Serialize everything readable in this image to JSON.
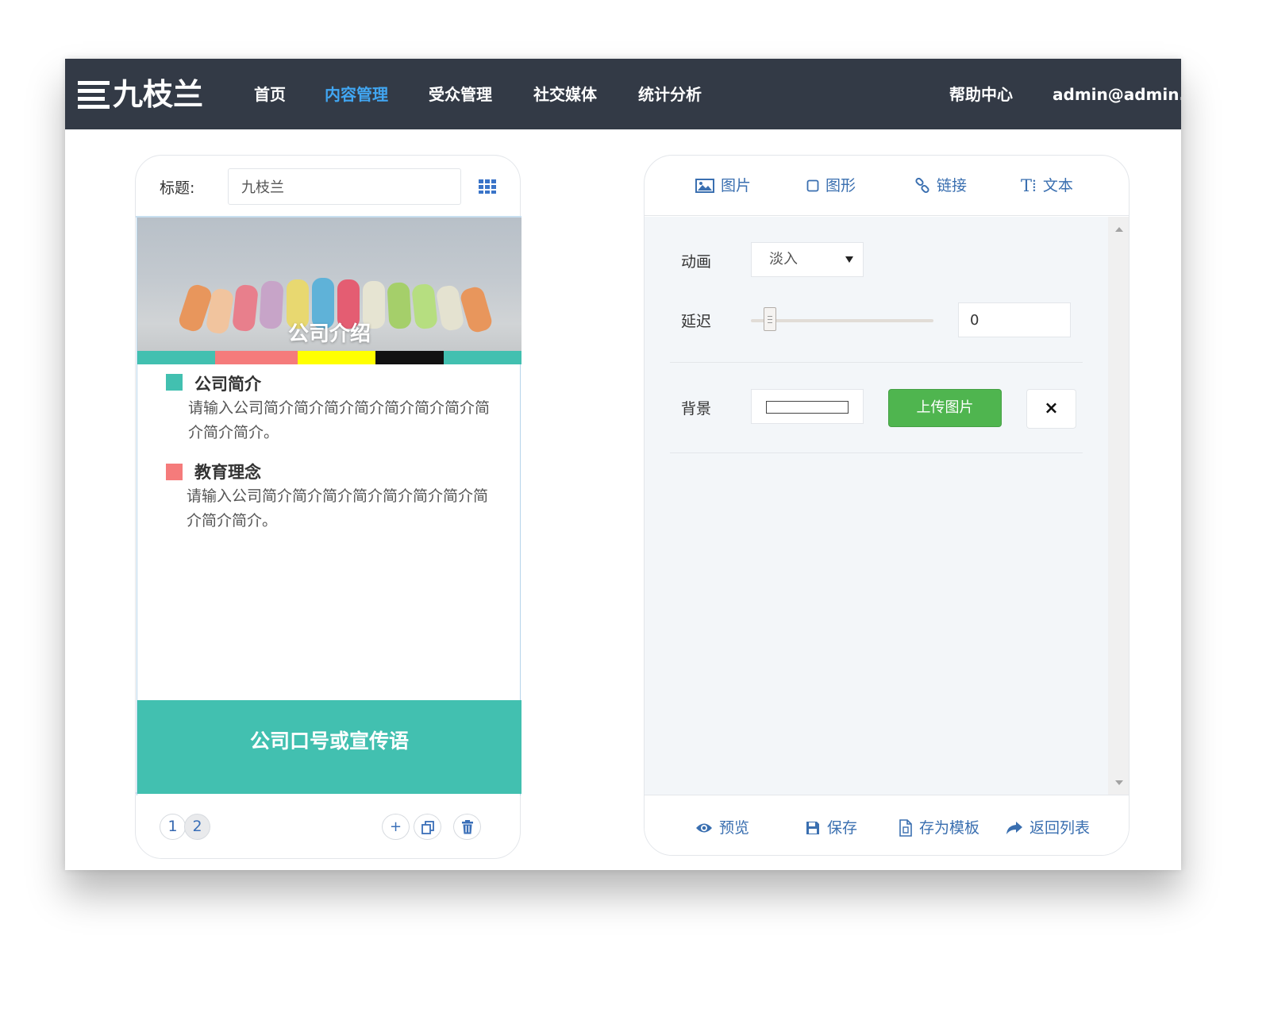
{
  "brand": {
    "logo_text": "九枝兰"
  },
  "nav": {
    "items": [
      {
        "label": "首页",
        "active": false
      },
      {
        "label": "内容管理",
        "active": true
      },
      {
        "label": "受众管理",
        "active": false
      },
      {
        "label": "社交媒体",
        "active": false
      },
      {
        "label": "统计分析",
        "active": false
      }
    ],
    "help": "帮助中心",
    "user": "admin@admin.c"
  },
  "editor": {
    "title_label": "标题:",
    "title_value": "九枝兰",
    "hero_caption": "公司介绍",
    "sections": [
      {
        "title": "公司简介",
        "body": "请输入公司简介简介简介简介简介简介简介简介简介简介。",
        "color": "#42c0b0"
      },
      {
        "title": "教育理念",
        "body": "请输入公司简介简介简介简介简介简介简介简介简介简介。",
        "color": "#f57b7b"
      }
    ],
    "slogan": "公司口号或宣传语",
    "color_bar": [
      "#42c0b0",
      "#f57b7b",
      "#ffff00",
      "#111111",
      "#42c0b0"
    ],
    "pages": [
      "1",
      "2"
    ],
    "active_page": "2",
    "tools": {
      "add": "+",
      "copy_icon": "copy-icon",
      "delete_icon": "trash-icon"
    }
  },
  "panel": {
    "tabs": [
      {
        "label": "图片",
        "icon": "image-icon"
      },
      {
        "label": "图形",
        "icon": "square-icon"
      },
      {
        "label": "链接",
        "icon": "link-icon"
      },
      {
        "label": "文本",
        "icon": "text-icon"
      }
    ],
    "animation": {
      "label": "动画",
      "value": "淡入"
    },
    "delay": {
      "label": "延迟",
      "value": "0",
      "slider_fraction": 0
    },
    "background": {
      "label": "背景",
      "color": "#ffffff",
      "upload_label": "上传图片",
      "clear_label": "×"
    },
    "footer": [
      {
        "label": "预览",
        "icon": "eye-icon"
      },
      {
        "label": "保存",
        "icon": "save-icon"
      },
      {
        "label": "存为模板",
        "icon": "file-icon"
      },
      {
        "label": "返回列表",
        "icon": "share-arrow-icon"
      }
    ]
  }
}
